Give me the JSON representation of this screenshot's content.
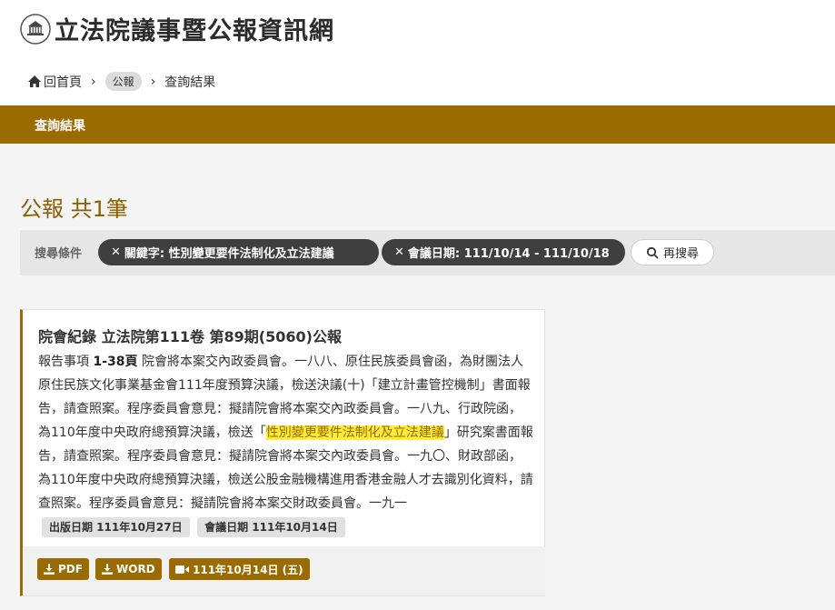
{
  "site": {
    "title": "立法院議事暨公報資訊網"
  },
  "breadcrumb": {
    "home": "回首頁",
    "section": "公報",
    "current": "查詢結果",
    "separator": "›"
  },
  "tab": {
    "label": "查詢結果"
  },
  "heading": "公報 共1筆",
  "filters": {
    "label": "搜尋條件",
    "chips": [
      {
        "remove": "✕",
        "text": "關鍵字: 性別變更要件法制化及立法建議"
      },
      {
        "remove": "✕",
        "text": "會議日期: 111/10/14 - 111/10/18"
      }
    ],
    "research_label": "再搜尋"
  },
  "result": {
    "title": "院會紀錄 立法院第111卷 第89期(5060)公報",
    "item_prefix": "報告事項",
    "pages": "1-38頁",
    "text_before": "院會將本案交內政委員會。一八八、原住民族委員會函，為財團法人原住民族文化事業基金會111年度預算決議，檢送決議(十)「建立計畫管控機制」書面報告，請查照案。程序委員會意見：擬請院會將本案交內政委員會。一八九、行政院函，為110年度中央政府總預算決議，檢送「",
    "highlight": "性別變更要件法制化及立法建議",
    "text_after": "」研究案書面報告，請查照案。程序委員會意見：擬請院會將本案交內政委員會。一九〇、財政部函，為110年度中央政府總預算決議，檢送公股金融機構進用香港金融人才去識別化資料，請查照案。程序委員會意見：擬請院會將本案交財政委員會。一九一",
    "publish_date": "出版日期 111年10月27日",
    "meeting_date": "會議日期 111年10月14日",
    "buttons": {
      "pdf": "PDF",
      "word": "WORD",
      "video": "111年10月14日 (五)"
    }
  },
  "colors": {
    "accent": "#9a6b00",
    "highlight": "#ffeb3b",
    "chip": "#3f3f3f"
  }
}
